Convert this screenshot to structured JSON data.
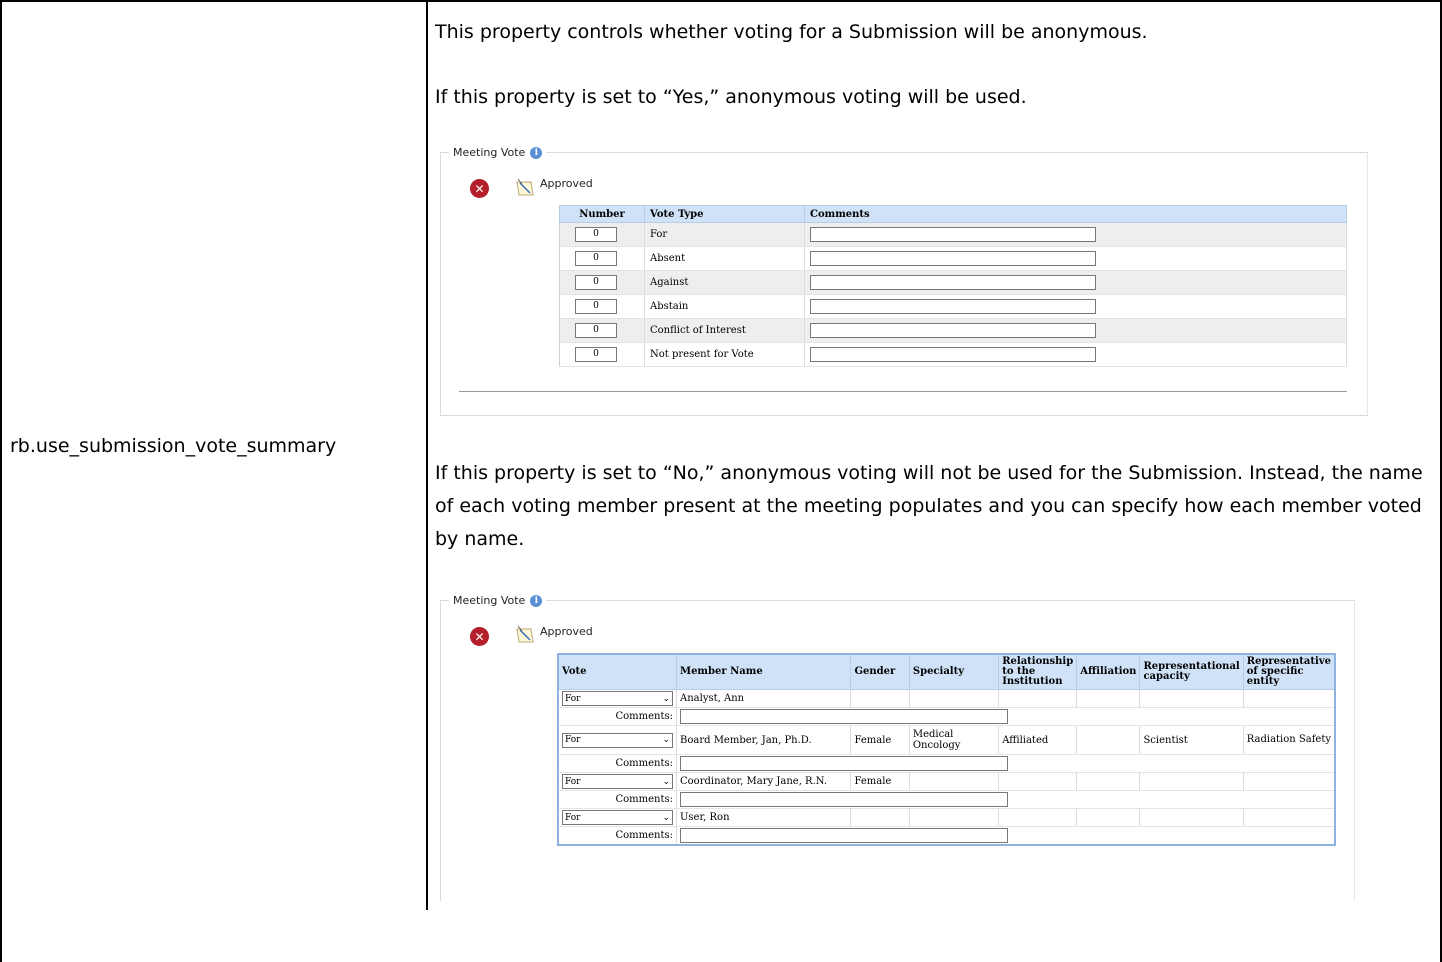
{
  "property_name": "rb.use_submission_vote_summary",
  "paragraphs": {
    "p1": "This property controls whether voting for a Submission will be anonymous.",
    "p2": "If this property is set to “Yes,” anonymous voting will be used.",
    "p3": "If this property is set to “No,” anonymous voting will not be used for the Submission. Instead, the name of each voting member present at the meeting populates and you can specify how each member voted by name."
  },
  "panel1": {
    "legend": "Meeting Vote",
    "status": "Approved",
    "headers": {
      "number": "Number",
      "vote_type": "Vote Type",
      "comments": "Comments"
    },
    "rows": [
      {
        "number": "0",
        "vote_type": "For"
      },
      {
        "number": "0",
        "vote_type": "Absent"
      },
      {
        "number": "0",
        "vote_type": "Against"
      },
      {
        "number": "0",
        "vote_type": "Abstain"
      },
      {
        "number": "0",
        "vote_type": "Conflict of Interest"
      },
      {
        "number": "0",
        "vote_type": "Not present for Vote"
      }
    ]
  },
  "panel2": {
    "legend": "Meeting Vote",
    "status": "Approved",
    "headers": {
      "vote": "Vote",
      "member_name": "Member Name",
      "gender": "Gender",
      "specialty": "Specialty",
      "relationship": "Relationship to the Institution",
      "affiliation": "Affiliation",
      "rep_capacity": "Representational capacity",
      "rep_entity": "Representative of specific entity"
    },
    "comments_label": "Comments:",
    "members": [
      {
        "vote": "For",
        "name": "Analyst, Ann",
        "gender": "",
        "specialty": "",
        "relationship": "",
        "affiliation": "",
        "rep_capacity": "",
        "rep_entity": ""
      },
      {
        "vote": "For",
        "name": "Board Member, Jan, Ph.D.",
        "gender": "Female",
        "specialty": "Medical Oncology",
        "relationship": "Affiliated",
        "affiliation": "",
        "rep_capacity": "Scientist",
        "rep_entity": "Radiation Safety"
      },
      {
        "vote": "For",
        "name": "Coordinator, Mary Jane, R.N.",
        "gender": "Female",
        "specialty": "",
        "relationship": "",
        "affiliation": "",
        "rep_capacity": "",
        "rep_entity": ""
      },
      {
        "vote": "For",
        "name": "User, Ron",
        "gender": "",
        "specialty": "",
        "relationship": "",
        "affiliation": "",
        "rep_capacity": "",
        "rep_entity": ""
      }
    ]
  }
}
